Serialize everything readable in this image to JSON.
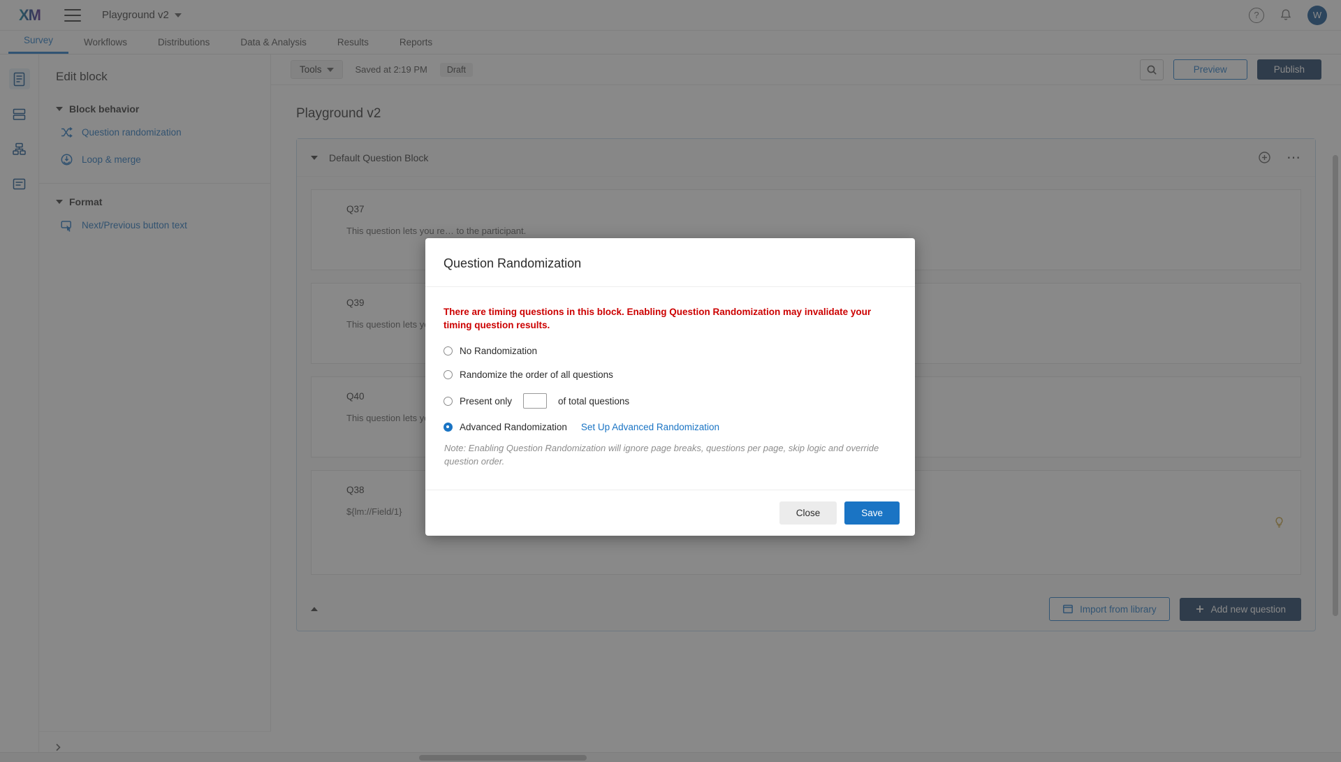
{
  "topbar": {
    "logo": "XM",
    "menu_icon": "hamburger-icon",
    "project_name": "Playground v2",
    "help_icon": "?",
    "bell_icon": "⚑",
    "avatar_initial": "W"
  },
  "tabs": [
    {
      "label": "Survey",
      "active": true
    },
    {
      "label": "Workflows",
      "active": false
    },
    {
      "label": "Distributions",
      "active": false
    },
    {
      "label": "Data & Analysis",
      "active": false
    },
    {
      "label": "Results",
      "active": false
    },
    {
      "label": "Reports",
      "active": false
    }
  ],
  "left_panel": {
    "title": "Edit block",
    "groups": [
      {
        "header": "Block behavior",
        "items": [
          {
            "label": "Question randomization",
            "icon": "shuffle-icon"
          },
          {
            "label": "Loop & merge",
            "icon": "loop-merge-icon"
          }
        ]
      },
      {
        "header": "Format",
        "items": [
          {
            "label": "Next/Previous button text",
            "icon": "button-text-icon"
          }
        ]
      }
    ],
    "expand_icon": "chevron-right-icon"
  },
  "toolbar": {
    "tools_label": "Tools",
    "saved_label": "Saved at 2:19 PM",
    "status_badge": "Draft",
    "search_icon": "search-icon",
    "preview_label": "Preview",
    "publish_label": "Publish"
  },
  "canvas": {
    "survey_title": "Playground v2",
    "block": {
      "name": "Default Question Block",
      "collapse_icon": "chevron-down-icon",
      "add_icon": "add-circle-icon",
      "more_icon": "more-options-icon",
      "questions": [
        {
          "id": "Q37",
          "text": "This question lets you re… to the participant.",
          "bulb": false
        },
        {
          "id": "Q39",
          "text": "This question lets you re… to the participant.",
          "bulb": false
        },
        {
          "id": "Q40",
          "text": "This question lets you re… to the participant.",
          "bulb": false
        },
        {
          "id": "Q38",
          "text": "${lm://Field/1}",
          "bulb": true
        }
      ],
      "footer": {
        "collapse_icon": "chevron-up-icon",
        "import_label": "Import from library",
        "add_question_label": "Add new question"
      }
    }
  },
  "modal": {
    "title": "Question Randomization",
    "warning": "There are timing questions in this block. Enabling Question Randomization may invalidate your timing question results.",
    "options": [
      {
        "label": "No Randomization",
        "selected": false
      },
      {
        "label": "Randomize the order of all questions",
        "selected": false
      },
      {
        "label_before": "Present only",
        "label_after": "of total questions",
        "input_value": "",
        "selected": false
      },
      {
        "label": "Advanced Randomization",
        "link": "Set Up Advanced Randomization",
        "selected": true
      }
    ],
    "note": "Note: Enabling Question Randomization will ignore page breaks, questions per page, skip logic and override question order.",
    "close_label": "Close",
    "save_label": "Save"
  },
  "colors": {
    "accent_blue": "#1a74c4",
    "navy": "#14365c",
    "warning_red": "#cc0000"
  }
}
